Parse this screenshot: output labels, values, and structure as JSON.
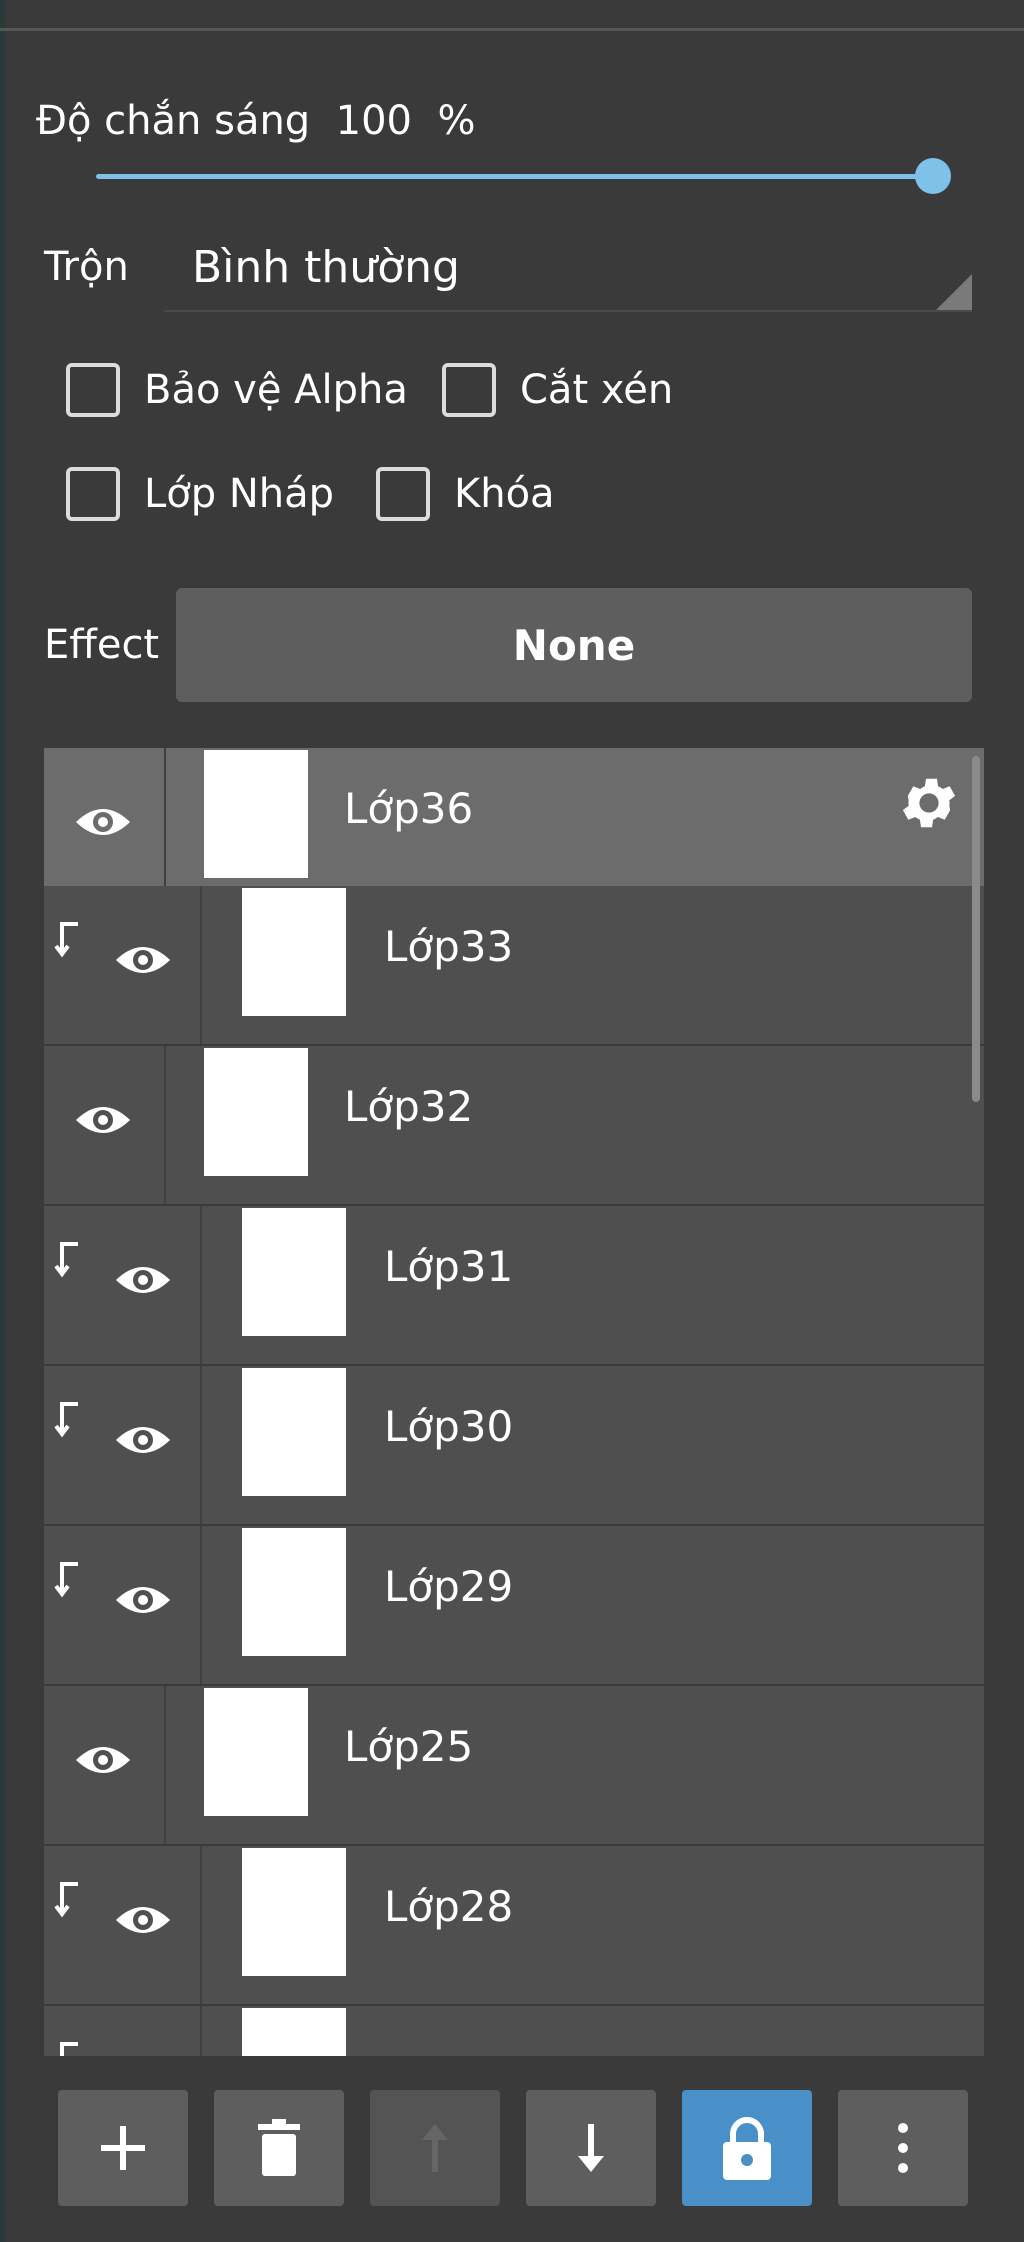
{
  "opacity": {
    "label": "Độ chắn sáng",
    "value": "100",
    "unit": "%",
    "level": 1.0
  },
  "blend": {
    "label": "Trộn",
    "value": "Bình thường"
  },
  "checkboxes": {
    "protect_alpha": "Bảo vệ Alpha",
    "clipping": "Cắt xén",
    "draft_layer": "Lớp Nháp",
    "lock": "Khóa"
  },
  "effect": {
    "label": "Effect",
    "value": "None"
  },
  "layers": [
    {
      "name": "Lớp36",
      "clipped": false,
      "selected": true
    },
    {
      "name": "Lớp33",
      "clipped": true,
      "selected": false
    },
    {
      "name": "Lớp32",
      "clipped": false,
      "selected": false
    },
    {
      "name": "Lớp31",
      "clipped": true,
      "selected": false
    },
    {
      "name": "Lớp30",
      "clipped": true,
      "selected": false
    },
    {
      "name": "Lớp29",
      "clipped": true,
      "selected": false
    },
    {
      "name": "Lớp25",
      "clipped": false,
      "selected": false
    },
    {
      "name": "Lớp28",
      "clipped": true,
      "selected": false
    },
    {
      "name": "",
      "clipped": true,
      "selected": false
    }
  ],
  "toolbar": {
    "buttons": [
      {
        "icon": "plus-icon"
      },
      {
        "icon": "trash-icon"
      },
      {
        "icon": "arrow-up-icon",
        "disabled": true
      },
      {
        "icon": "arrow-down-icon"
      },
      {
        "icon": "lock-icon",
        "active": true
      },
      {
        "icon": "more-vertical-icon"
      }
    ]
  },
  "colors": {
    "accent": "#7ec2ea",
    "active_button": "#4a90c8",
    "panel_bg": "#3a3a3a",
    "row_bg": "#4f4f4f",
    "row_selected": "#6c6c6c"
  }
}
